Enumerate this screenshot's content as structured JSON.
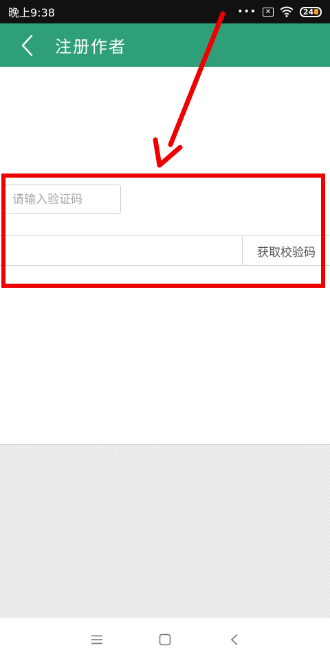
{
  "status_bar": {
    "time": "晚上9:38",
    "battery": "24",
    "icons": [
      "more-dots-icon",
      "sim-x-icon",
      "wifi-icon",
      "battery-icon"
    ]
  },
  "app_bar": {
    "title": "注册作者",
    "back_icon": "chevron-left-icon",
    "color": "#2f9f7a"
  },
  "form": {
    "verification_code_placeholder": "请输入验证码",
    "phone_value": "",
    "get_code_label": "获取校验码"
  },
  "annotation": {
    "color": "#ee0000"
  },
  "nav_bar": {
    "icons": [
      "menu-icon",
      "home-square-icon",
      "back-chevron-icon"
    ]
  }
}
